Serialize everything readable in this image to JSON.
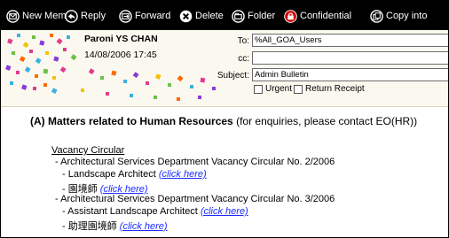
{
  "toolbar": {
    "new_memo": "New Memo",
    "reply": "Reply",
    "forward": "Forward",
    "delete": "Delete",
    "folder": "Folder",
    "confidential": "Confidential",
    "copy_into": "Copy into"
  },
  "header": {
    "sender": "Paroni YS CHAN",
    "date": "14/08/2006 17:45",
    "to_label": "To:",
    "to_value": "%All_GOA_Users",
    "cc_label": "cc:",
    "cc_value": "",
    "subject_label": "Subject:",
    "subject_value": "Admin Bulletin",
    "urgent_label": "Urgent",
    "receipt_label": "Return Receipt"
  },
  "body": {
    "heading_bold": "(A) Matters related to Human Resources",
    "heading_rest": " (for enquiries, please contact EO(HR))",
    "vacancy_title": "Vacancy Circular",
    "circular1": "- Architectural Services Department Vacancy Circular No. 2/2006",
    "post1_en": "- Landscape Architect",
    "post1_zh": "- 園境師",
    "circular2": "- Architectural Services Department Vacancy Circular No. 3/2006",
    "post2_en": "- Assistant Landscape Architect",
    "post2_zh": "- 助理園境師",
    "click_here": "(click here)"
  },
  "colors": {
    "toolbar_bg": "#000000",
    "header_bg": "#fbf9ef",
    "link": "#1a2bff",
    "confidential_icon": "#d40000"
  },
  "icons": [
    "new-memo-icon",
    "reply-icon",
    "forward-icon",
    "delete-icon",
    "folder-icon",
    "confidential-icon",
    "copy-into-icon"
  ]
}
